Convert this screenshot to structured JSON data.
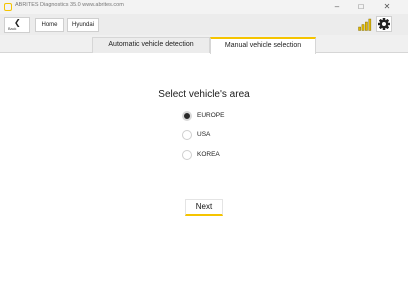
{
  "window": {
    "title": "ABRITES Diagnostics 35.0   www.abrites.com",
    "controls": {
      "minimize": "–",
      "maximize": "□",
      "close": "✕"
    }
  },
  "toolbar": {
    "back_label": "Back",
    "breadcrumbs": [
      "Home",
      "Hyundai"
    ],
    "signal_icon": "signal-bars-icon",
    "settings_icon": "gear-icon"
  },
  "tabs": [
    {
      "label": "Automatic vehicle detection",
      "active": false
    },
    {
      "label": "Manual vehicle selection",
      "active": true
    }
  ],
  "panel": {
    "title": "Select vehicle's area",
    "options": [
      {
        "label": "EUROPE",
        "selected": true
      },
      {
        "label": "USA",
        "selected": false
      },
      {
        "label": "KOREA",
        "selected": false
      }
    ],
    "next_label": "Next"
  },
  "colors": {
    "accent": "#f5c400",
    "background": "#ffffff",
    "toolbar": "#ececec"
  }
}
